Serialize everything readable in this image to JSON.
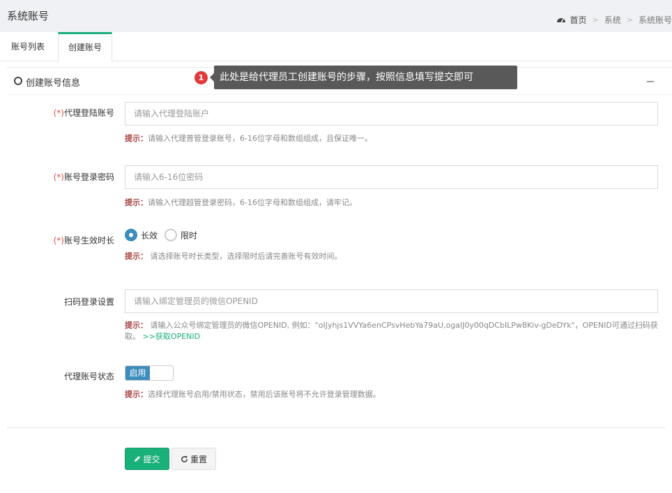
{
  "header": {
    "title": "系统账号",
    "breadcrumb": [
      "首页",
      "系统",
      "系统账号"
    ]
  },
  "tabs": [
    {
      "label": "账号列表",
      "active": false
    },
    {
      "label": "创建账号",
      "active": true
    }
  ],
  "section": {
    "title": "创建账号信息"
  },
  "tooltip": {
    "badge": "1",
    "text": "此处是给代理员工创建账号的步骤，按照信息填写提交即可"
  },
  "form": {
    "required_mark": "(*)",
    "hint_label": "提示：",
    "login_account": {
      "label": "代理登陆账号",
      "placeholder": "请输入代理登陆账户",
      "hint": "请输入代理普管登录账号，6-16位字母和数组组成，且保证唯一。"
    },
    "password": {
      "label": "账号登录密码",
      "placeholder": "请输入6-16位密码",
      "hint": "请输入代理超管登录密码，6-16位字母和数组组成，请牢记。"
    },
    "validity": {
      "label": "账号生效时长",
      "options": [
        "长效",
        "限时"
      ],
      "selected": "长效",
      "hint": " 请选择账号时长类型，选择限时后请完善账号有效时间。"
    },
    "qr_login": {
      "label": "扫码登录设置",
      "placeholder": "请输入绑定管理员的微信OPENID",
      "hint": " 请输入公众号绑定管理员的微信OPENID, 例如：\"oIJyhjs1VVYa6enCPsvHebYa79aU,ogalJ0y00qDCbILPw8Kiv-gDeDYk\"，OPENID可通过扫码获取。 ",
      "link": ">>获取OPENID"
    },
    "status": {
      "label": "代理账号状态",
      "switch_label": "启用",
      "hint": "选择代理账号启用/禁用状态，禁用后该账号将不允许登录管理数据。"
    }
  },
  "actions": {
    "submit": "提交",
    "reset": "重置"
  },
  "colors": {
    "accent": "#1ab07a",
    "primary": "#3c8dbc",
    "tooltip_bg": "#595959",
    "badge": "#e23a3a",
    "required": "#d9534f"
  }
}
